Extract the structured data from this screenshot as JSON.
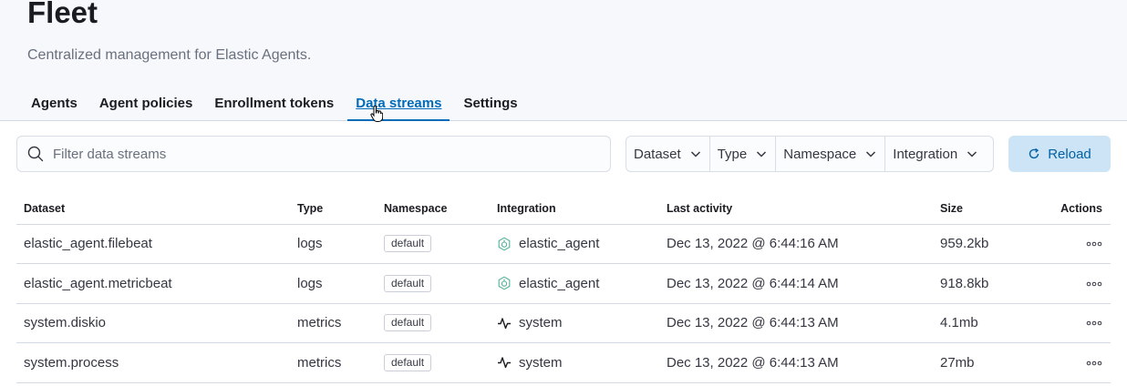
{
  "header": {
    "title": "Fleet",
    "description": "Centralized management for Elastic Agents."
  },
  "tabs": [
    {
      "label": "Agents"
    },
    {
      "label": "Agent policies"
    },
    {
      "label": "Enrollment tokens"
    },
    {
      "label": "Data streams",
      "active": true
    },
    {
      "label": "Settings"
    }
  ],
  "search": {
    "placeholder": "Filter data streams",
    "value": ""
  },
  "filters": [
    {
      "label": "Dataset"
    },
    {
      "label": "Type"
    },
    {
      "label": "Namespace"
    },
    {
      "label": "Integration"
    }
  ],
  "reload": {
    "label": "Reload"
  },
  "table": {
    "columns": [
      "Dataset",
      "Type",
      "Namespace",
      "Integration",
      "Last activity",
      "Size",
      "Actions"
    ],
    "rows": [
      {
        "dataset": "elastic_agent.filebeat",
        "type": "logs",
        "namespace": "default",
        "integration": "elastic_agent",
        "integration_icon": "elastic-agent-icon",
        "last_activity": "Dec 13, 2022 @ 6:44:16 AM",
        "size": "959.2kb"
      },
      {
        "dataset": "elastic_agent.metricbeat",
        "type": "logs",
        "namespace": "default",
        "integration": "elastic_agent",
        "integration_icon": "elastic-agent-icon",
        "last_activity": "Dec 13, 2022 @ 6:44:14 AM",
        "size": "918.8kb"
      },
      {
        "dataset": "system.diskio",
        "type": "metrics",
        "namespace": "default",
        "integration": "system",
        "integration_icon": "pulse-icon",
        "last_activity": "Dec 13, 2022 @ 6:44:13 AM",
        "size": "4.1mb"
      },
      {
        "dataset": "system.process",
        "type": "metrics",
        "namespace": "default",
        "integration": "system",
        "integration_icon": "pulse-icon",
        "last_activity": "Dec 13, 2022 @ 6:44:13 AM",
        "size": "27mb"
      }
    ]
  },
  "colors": {
    "accent": "#006bb8",
    "reload_bg": "#cce4f5",
    "header_bg": "#f7f8fc",
    "agent_icon": "#54b399"
  }
}
